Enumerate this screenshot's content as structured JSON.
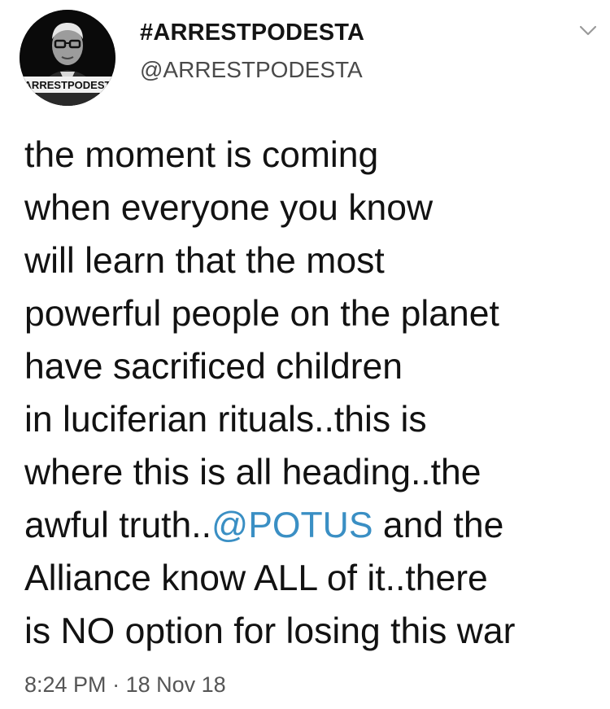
{
  "tweet": {
    "display_name": "#ARRESTPODESTA",
    "handle": "@ARRESTPODESTA",
    "avatar_text": "ARRESTPODEST",
    "body": {
      "line1": "the moment is coming",
      "line2": "when everyone you know",
      "line3": "will learn that the most",
      "line4": "powerful people on the planet",
      "line5": "have sacrificed children",
      "line6": "in luciferian rituals..this is",
      "line7": "where this is all heading..the",
      "line8_pre": "awful truth..",
      "line8_mention": "@POTUS",
      "line8_post": " and the",
      "line9": "Alliance know ALL of it..there",
      "line10": "is NO option for losing this war"
    },
    "time": "8:24 PM",
    "separator": "·",
    "date": "18 Nov 18"
  },
  "colors": {
    "mention": "#3a8fc4",
    "text": "#121212",
    "meta": "#555555"
  },
  "icons": {
    "caret": "chevron-down-icon"
  }
}
